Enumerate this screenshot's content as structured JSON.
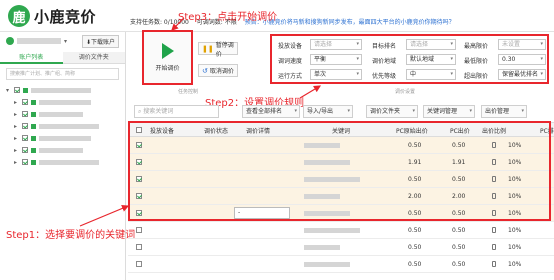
{
  "app": {
    "logo_text": "小鹿竞价",
    "logo_glyph": "鹿",
    "colors": {
      "brand": "#2fa84f",
      "annotation": "#e8262d",
      "highlight_row": "#fcf3e3"
    }
  },
  "header": {
    "task_count": "支持任务数: 0/10000",
    "adjust_count": "可调词数: 不限",
    "notice": "预告：小鹿竞价将马新和搜狗新同步发布，最面四大平台的小鹿竞价你期待吗？"
  },
  "annotations": {
    "step3": "Step3：点击开始调价",
    "step2": "Step2：设置调价规则",
    "step1": "Step1：选择要调价的关键词"
  },
  "left": {
    "download_label": "下载账户",
    "tabs": [
      "账户列表",
      "调价文件夹"
    ],
    "search_placeholder": "搜索推广计划、推广组、简称",
    "tree_rows": 7
  },
  "actions": {
    "start_label": "开始调价",
    "pause_label": "暂停调价",
    "cancel_label": "取消调价",
    "section_task": "任务控制",
    "section_settings": "调价设置"
  },
  "settings": {
    "row1": [
      {
        "label": "投放设备",
        "value": "请选择",
        "placeholder": true
      },
      {
        "label": "目标排名",
        "value": "请选择",
        "placeholder": true
      },
      {
        "label": "最高限价",
        "value": "未设置",
        "placeholder": true
      }
    ],
    "row2": [
      {
        "label": "调词速度",
        "value": "平衡",
        "placeholder": false
      },
      {
        "label": "调价地域",
        "value": "默认地域",
        "placeholder": false
      },
      {
        "label": "最低限价",
        "value": "0.30",
        "placeholder": false
      }
    ],
    "row3": [
      {
        "label": "运行方式",
        "value": "单次",
        "placeholder": false
      },
      {
        "label": "优先等级",
        "value": "中",
        "placeholder": false
      },
      {
        "label": "超出限价",
        "value": "保留最优排名",
        "placeholder": false
      }
    ]
  },
  "toolbar": {
    "search_placeholder": "搜索关键词",
    "view_all": "查看全部排名",
    "import_export": "导入/导出",
    "add_folder": "调价文件夹",
    "keyword_manage": "关键词管理",
    "bid_manage": "出价管理"
  },
  "table": {
    "headers": [
      "投放设备",
      "调价状态",
      "调价详情",
      "关键词",
      "PC原始出价",
      "PC出价",
      "出价比例",
      "PC排"
    ],
    "rows": [
      {
        "checked": true,
        "pc_orig": "0.50",
        "pc_bid": "0.50",
        "ratio": "10%",
        "highlight": true
      },
      {
        "checked": true,
        "pc_orig": "1.91",
        "pc_bid": "1.91",
        "ratio": "10%",
        "highlight": true
      },
      {
        "checked": true,
        "pc_orig": "0.50",
        "pc_bid": "0.50",
        "ratio": "10%",
        "highlight": true
      },
      {
        "checked": true,
        "pc_orig": "2.00",
        "pc_bid": "2.00",
        "ratio": "10%",
        "highlight": true
      },
      {
        "checked": true,
        "pc_orig": "0.50",
        "pc_bid": "0.50",
        "ratio": "10%",
        "highlight": true,
        "detail": "-"
      },
      {
        "checked": false,
        "pc_orig": "0.50",
        "pc_bid": "0.50",
        "ratio": "10%",
        "highlight": false
      },
      {
        "checked": false,
        "pc_orig": "0.50",
        "pc_bid": "0.50",
        "ratio": "10%",
        "highlight": false
      },
      {
        "checked": false,
        "pc_orig": "0.50",
        "pc_bid": "0.50",
        "ratio": "10%",
        "highlight": false
      }
    ]
  }
}
